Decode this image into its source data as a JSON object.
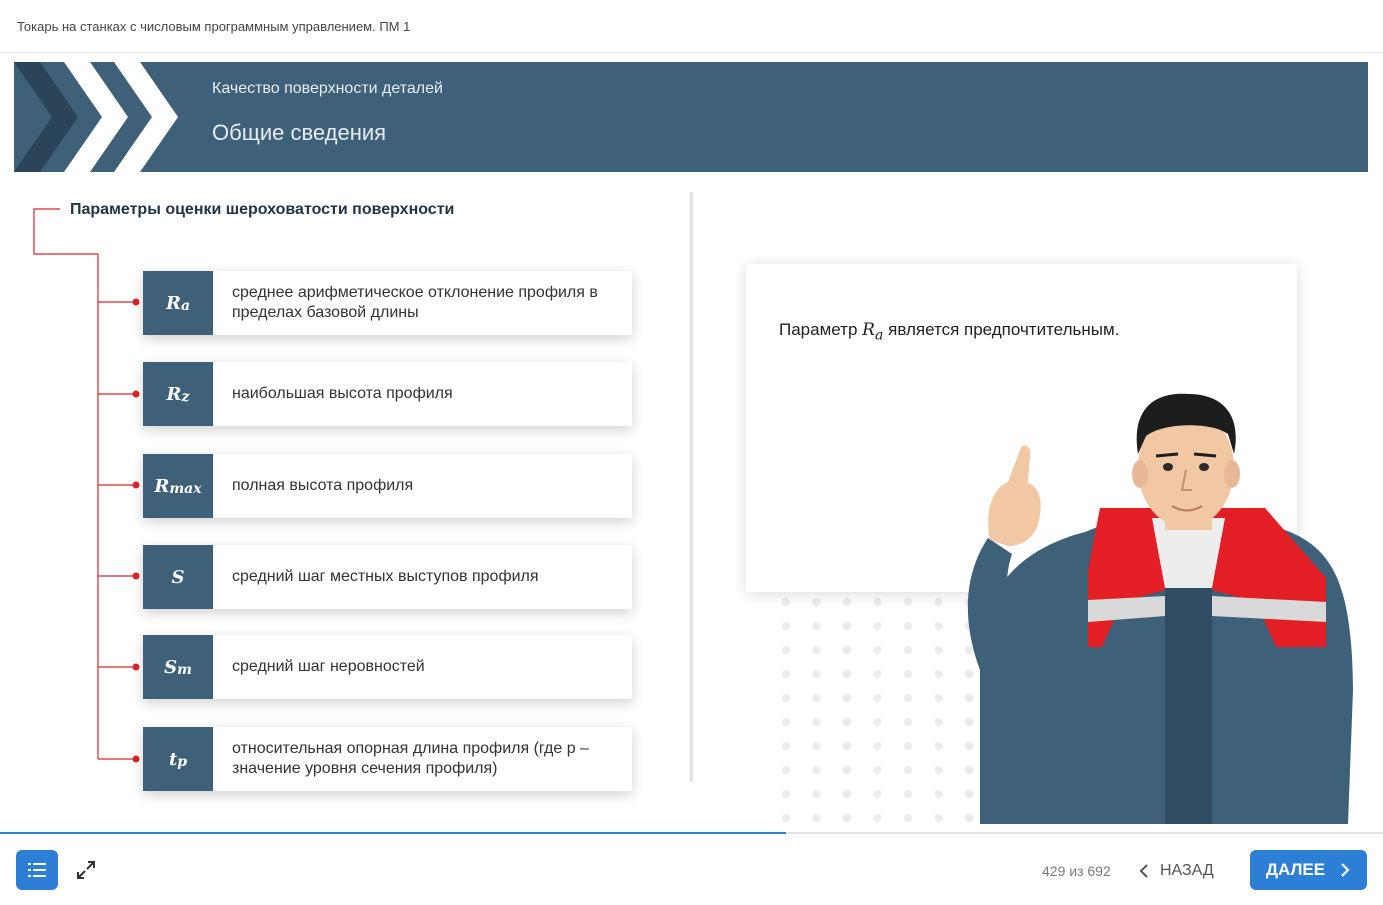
{
  "header": {
    "course_title": "Токарь на станках с числовым программным управлением. ПМ 1"
  },
  "banner": {
    "subtitle": "Качество поверхности деталей",
    "title": "Общие сведения"
  },
  "colors": {
    "primary": "#3e6079",
    "accent_red": "#d9262c",
    "button_blue": "#2d7fd6"
  },
  "params": {
    "heading": "Параметры оценки шероховатости поверхности",
    "items": [
      {
        "symbol": "R",
        "sub": "a",
        "text": "среднее арифметическое отклонение профиля в пределах базовой длины"
      },
      {
        "symbol": "R",
        "sub": "z",
        "text": "наибольшая высота профиля"
      },
      {
        "symbol": "R",
        "sub": "max",
        "text": "полная высота профиля"
      },
      {
        "symbol": "S",
        "sub": "",
        "text": "средний шаг местных выступов профиля"
      },
      {
        "symbol": "S",
        "sub": "m",
        "text": "средний шаг неровностей"
      },
      {
        "symbol": "t",
        "sub": "p",
        "text": "относительная опорная длина профиля (где p – значение уровня сечения профиля)"
      }
    ]
  },
  "note": {
    "before": "Параметр ",
    "symbol": "R",
    "sub": "a",
    "after": " является предпочтительным."
  },
  "footer": {
    "counter": "429 из 692",
    "back_label": "НАЗАД",
    "next_label": "ДАЛЕЕ",
    "progress_fraction": 0.568,
    "menu_icon": "list-icon",
    "expand_icon": "expand-icon"
  }
}
